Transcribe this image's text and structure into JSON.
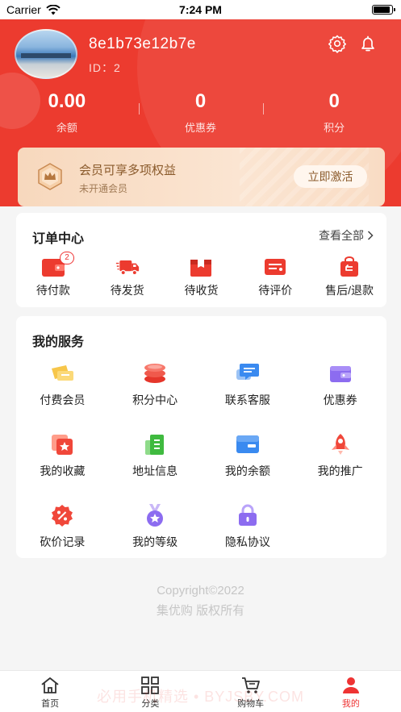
{
  "status_bar": {
    "carrier": "Carrier",
    "time": "7:24 PM"
  },
  "profile": {
    "username": "8e1b73e12b7e",
    "user_id": "ID：2"
  },
  "stats": [
    {
      "value": "0.00",
      "label": "余额"
    },
    {
      "value": "0",
      "label": "优惠券"
    },
    {
      "value": "0",
      "label": "积分"
    }
  ],
  "member": {
    "title": "会员可享多项权益",
    "subtitle": "未开通会员",
    "activate": "立即激活"
  },
  "orders": {
    "title": "订单中心",
    "view_all": "查看全部",
    "items": [
      {
        "label": "待付款",
        "badge": "2"
      },
      {
        "label": "待发货"
      },
      {
        "label": "待收货"
      },
      {
        "label": "待评价"
      },
      {
        "label": "售后/退款"
      }
    ]
  },
  "services": {
    "title": "我的服务",
    "items": [
      {
        "label": "付费会员",
        "icon": "vip-card-icon"
      },
      {
        "label": "积分中心",
        "icon": "coins-stack-icon"
      },
      {
        "label": "联系客服",
        "icon": "chat-bubble-icon"
      },
      {
        "label": "优惠券",
        "icon": "wallet-icon"
      },
      {
        "label": "我的收藏",
        "icon": "favorites-icon"
      },
      {
        "label": "地址信息",
        "icon": "address-book-icon"
      },
      {
        "label": "我的余额",
        "icon": "balance-card-icon"
      },
      {
        "label": "我的推广",
        "icon": "rocket-icon"
      },
      {
        "label": "砍价记录",
        "icon": "discount-icon"
      },
      {
        "label": "我的等级",
        "icon": "medal-icon"
      },
      {
        "label": "隐私协议",
        "icon": "lock-icon"
      }
    ]
  },
  "footer": {
    "copyright": "Copyright©2022",
    "rights": "集优购 版权所有"
  },
  "tabs": [
    {
      "label": "首页",
      "icon": "home-icon"
    },
    {
      "label": "分类",
      "icon": "grid-icon"
    },
    {
      "label": "购物车",
      "icon": "cart-icon"
    },
    {
      "label": "我的",
      "icon": "user-icon"
    }
  ],
  "watermark": "必用手机精选 • BYJSBY.COM",
  "colors": {
    "primary": "#ec3b2f",
    "member_gold": "#8a5a2b",
    "background": "#f5f5f5"
  }
}
